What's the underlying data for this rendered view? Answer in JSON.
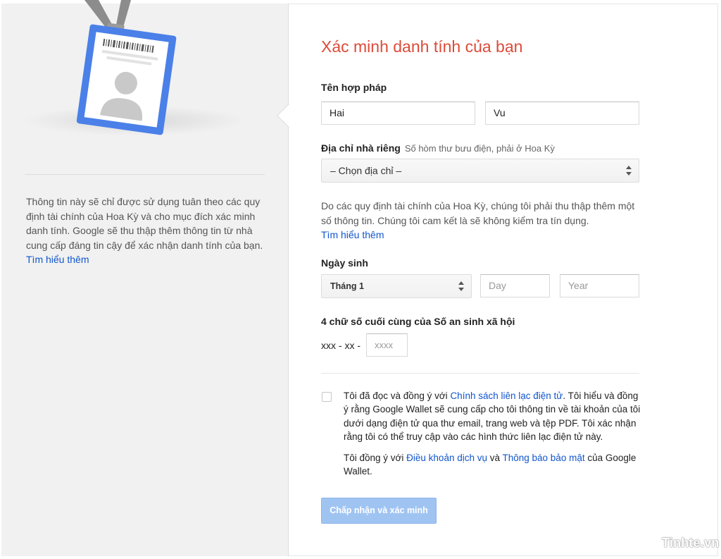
{
  "sidebar": {
    "info_text": "Thông tin này sẽ chỉ được sử dụng tuân theo các quy định tài chính của Hoa Kỳ và cho mục đích xác minh danh tính. Google sẽ thu thập thêm thông tin từ nhà cung cấp đáng tin cậy để xác nhận danh tính của bạn.",
    "learn_more": "Tìm hiểu thêm",
    "illustration_icon": "id-badge-icon"
  },
  "form": {
    "title": "Xác minh danh tính của bạn",
    "legal_name": {
      "label": "Tên hợp pháp",
      "first_value": "Hai",
      "last_value": "Vu"
    },
    "address": {
      "label": "Địa chỉ nhà riêng",
      "hint": "Số hòm thư bưu điện, phải ở Hoa Kỳ",
      "select_value": "– Chọn địa chỉ –"
    },
    "disclaimer": {
      "text": "Do các quy định tài chính của Hoa Kỳ, chúng tôi phải thu thập thêm một số thông tin. Chúng tôi cam kết là sẽ không kiểm tra tín dụng.",
      "learn_more": "Tìm hiểu thêm"
    },
    "birthdate": {
      "label": "Ngày sinh",
      "month_value": "Tháng 1",
      "day_placeholder": "Day",
      "year_placeholder": "Year"
    },
    "ssn": {
      "label": "4 chữ số cuối cùng của Số an sinh xã hội",
      "prefix": "xxx - xx -",
      "placeholder": "xxxx"
    },
    "consent": {
      "part1": "Tôi đã đọc và đồng ý với ",
      "link1": "Chính sách liên lạc điện tử",
      "part2": ". Tôi hiểu và đồng ý rằng Google Wallet sẽ cung cấp cho tôi thông tin về tài khoản của tôi dưới dạng điện tử qua thư email, trang web và tệp PDF. Tôi xác nhận rằng tôi có thể truy cập vào các hình thức liên lạc điện tử này.",
      "tos_part1": "Tôi đồng ý với ",
      "tos_link": "Điều khoản dịch vụ",
      "tos_and": " và ",
      "privacy_link": "Thông báo bảo mật",
      "tos_part2": " của Google Wallet."
    },
    "submit_label": "Chấp nhận và xác minh"
  },
  "watermark": "Tinhte.vn",
  "colors": {
    "title": "#dd4b39",
    "link": "#1155cc",
    "button": "#a0c4f2",
    "badge": "#4a80e8"
  }
}
